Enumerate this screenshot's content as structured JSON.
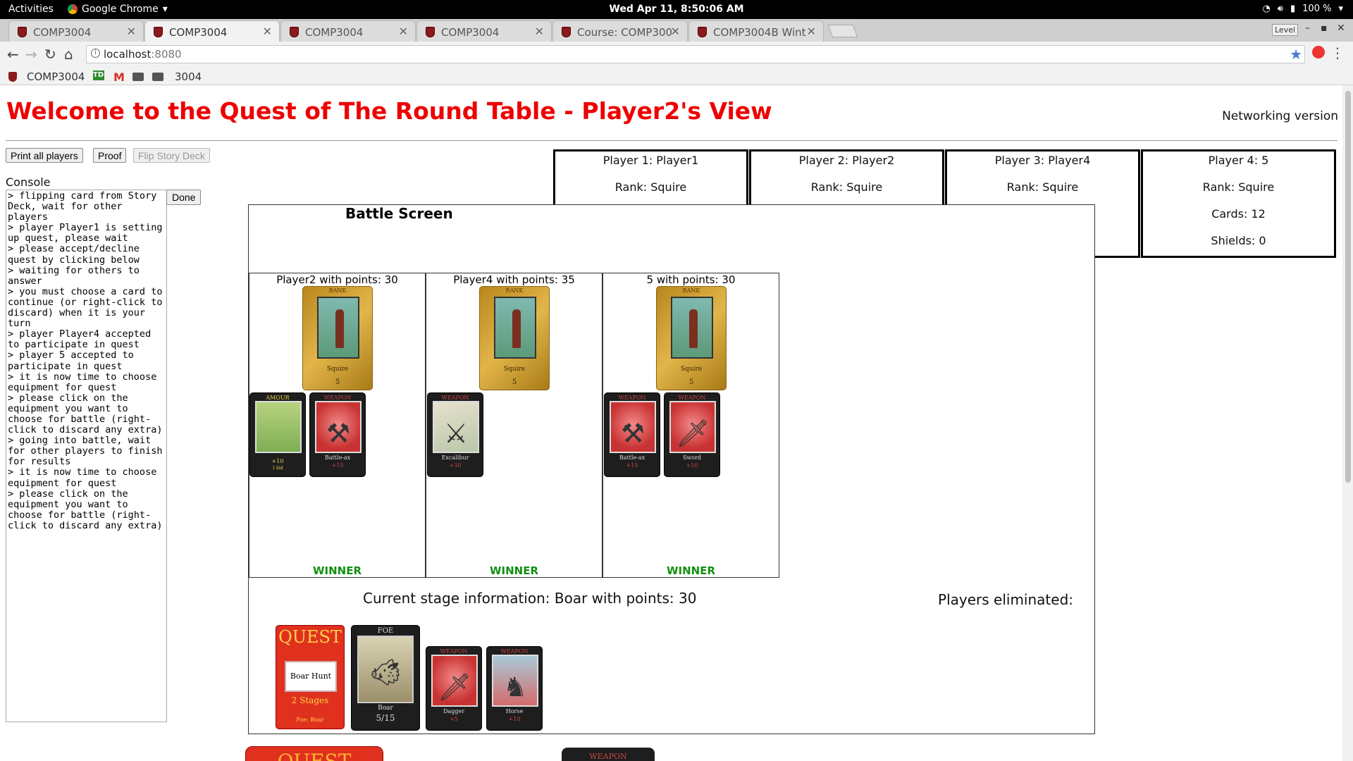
{
  "os": {
    "activities": "Activities",
    "app_menu": "Google Chrome",
    "clock": "Wed Apr 11,  8:50:06 AM",
    "battery": "100 %"
  },
  "browser": {
    "tabs": [
      {
        "title": "COMP3004",
        "active": false
      },
      {
        "title": "COMP3004",
        "active": true
      },
      {
        "title": "COMP3004",
        "active": false
      },
      {
        "title": "COMP3004",
        "active": false
      },
      {
        "title": "Course: COMP300",
        "active": false
      },
      {
        "title": "COMP3004B Wint",
        "active": false
      }
    ],
    "level_badge": "Level",
    "url_host": "localhost",
    "url_port": ":8080",
    "bookmarks": [
      "COMP3004",
      "3004"
    ]
  },
  "page": {
    "title": "Welcome to the Quest of The Round Table - Player2's View",
    "network_label": "Networking version",
    "buttons": {
      "print_all": "Print all players",
      "proof": "Proof",
      "flip_story": "Flip Story Deck"
    },
    "console_label": "Console",
    "console_text": "> flipping card from Story Deck, wait for other players\n> player Player1 is setting up quest, please wait\n> please accept/decline quest by clicking below\n> waiting for others to answer\n> you must choose a card to continue (or right-click to discard) when it is your turn\n> player Player4 accepted to participate in quest\n> player 5 accepted to participate in quest\n> it is now time to choose equipment for quest\n> please click on the equipment you want to choose for battle (right-click to discard any extra)\n> going into battle, wait for other players to finish for results\n> it is now time to choose equipment for quest\n> please click on the equipment you want to choose for battle (right-click to discard any extra)",
    "done_label": "Done",
    "players": [
      {
        "name": "Player 1: Player1",
        "rank": "Rank: Squire"
      },
      {
        "name": "Player 2: Player2",
        "rank": "Rank: Squire"
      },
      {
        "name": "Player 3: Player4",
        "rank": "Rank: Squire"
      },
      {
        "name": "Player 4: 5",
        "rank": "Rank: Squire",
        "cards": "Cards: 12",
        "shields": "Shields: 0"
      }
    ]
  },
  "battle": {
    "title": "Battle Screen",
    "participants": [
      {
        "label": "Player2 with points: 30",
        "rank_card": {
          "head": "RANK",
          "name": "Squire",
          "value": "5"
        },
        "cards": [
          {
            "kind": "amour",
            "head": "AMOUR",
            "name": "",
            "value": "+10",
            "extra": "1 bid"
          },
          {
            "kind": "weapon",
            "head": "WEAPON",
            "name": "Battle-ax",
            "value": "+15"
          }
        ],
        "result": "WINNER"
      },
      {
        "label": "Player4 with points: 35",
        "rank_card": {
          "head": "RANK",
          "name": "Squire",
          "value": "5"
        },
        "cards": [
          {
            "kind": "weapon",
            "head": "WEAPON",
            "name": "Excalibur",
            "value": "+30"
          }
        ],
        "result": "WINNER"
      },
      {
        "label": "5 with points: 30",
        "rank_card": {
          "head": "RANK",
          "name": "Squire",
          "value": "5"
        },
        "cards": [
          {
            "kind": "weapon",
            "head": "WEAPON",
            "name": "Battle-ax",
            "value": "+15"
          },
          {
            "kind": "weapon",
            "head": "WEAPON",
            "name": "Sword",
            "value": "+10"
          }
        ],
        "result": "WINNER"
      }
    ],
    "stage_info": "Current stage information: Boar with points: 30",
    "eliminated_label": "Players eliminated:",
    "stage_cards": {
      "quest": {
        "title": "QUEST",
        "name": "Boar Hunt",
        "stages": "2 Stages",
        "foe": "Foe: Boar"
      },
      "foe": {
        "head": "FOE",
        "name": "Boar",
        "points": "5/15"
      },
      "weapons": [
        {
          "head": "WEAPON",
          "name": "Dagger",
          "value": "+5"
        },
        {
          "head": "WEAPON",
          "name": "Horse",
          "value": "+10"
        }
      ]
    }
  },
  "below": {
    "quest_peek": "QUEST",
    "weapon_peek": "WEAPON"
  },
  "colors": {
    "title_red": "#ee0000",
    "winner_green": "#119111"
  }
}
